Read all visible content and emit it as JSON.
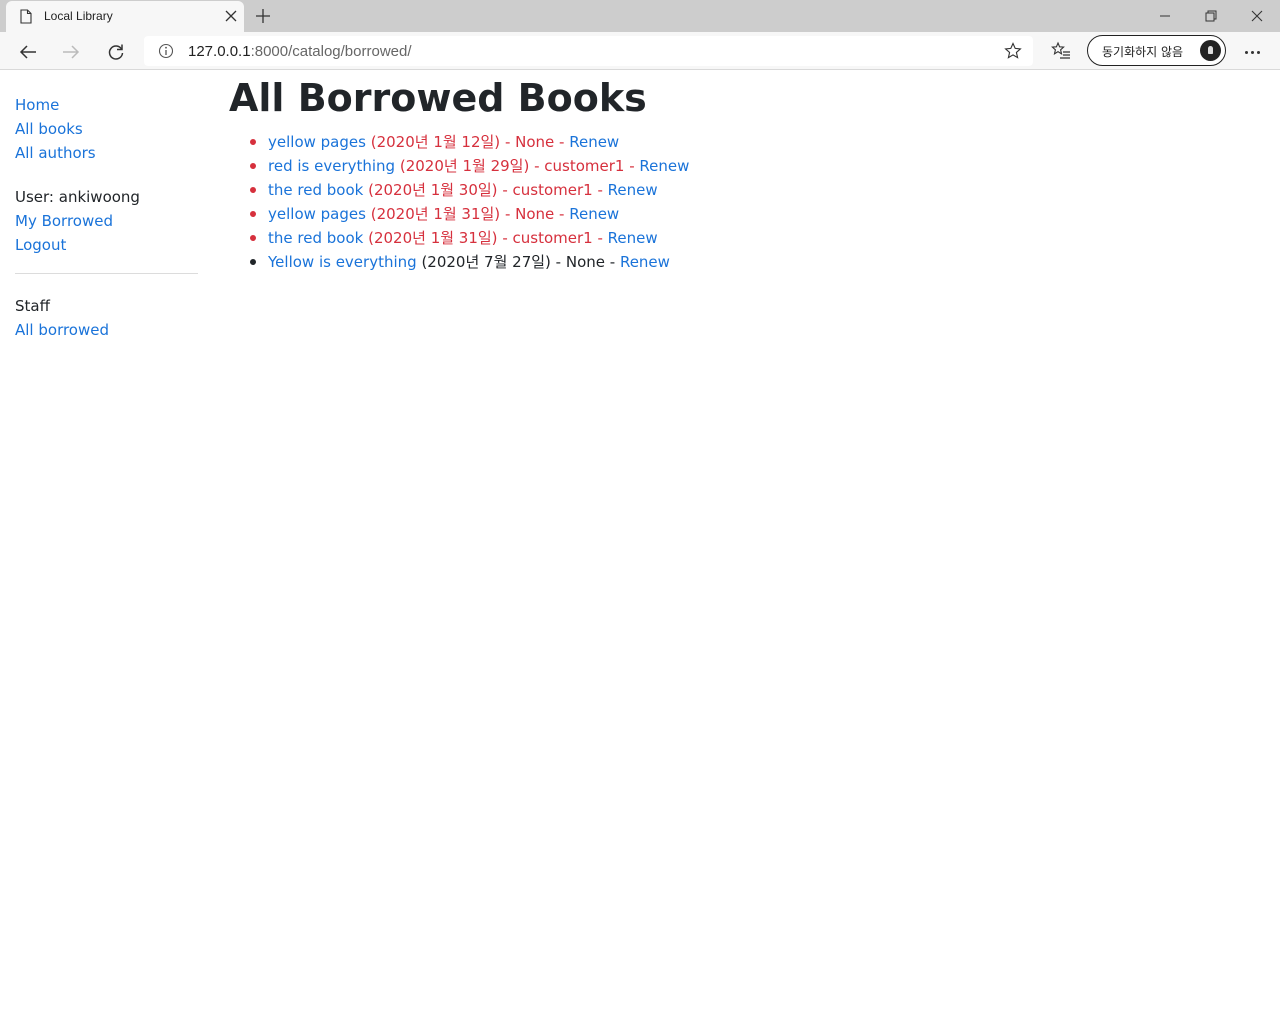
{
  "browser": {
    "tab_title": "Local Library",
    "url_host": "127.0.0.1",
    "url_rest": ":8000/catalog/borrowed/",
    "profile_label": "동기화하지 않음"
  },
  "sidebar": {
    "links": [
      "Home",
      "All books",
      "All authors"
    ],
    "user_label": "User: ankiwoong",
    "user_links": [
      "My Borrowed",
      "Logout"
    ],
    "staff_heading": "Staff",
    "staff_links": [
      "All borrowed"
    ]
  },
  "main": {
    "title": "All Borrowed Books",
    "books": [
      {
        "title": "yellow pages",
        "due": "(2020년 1월 12일)",
        "borrower": "None",
        "action": "Renew",
        "overdue": true
      },
      {
        "title": "red is everything",
        "due": "(2020년 1월 29일)",
        "borrower": "customer1",
        "action": "Renew",
        "overdue": true
      },
      {
        "title": "the red book",
        "due": "(2020년 1월 30일)",
        "borrower": "customer1",
        "action": "Renew",
        "overdue": true
      },
      {
        "title": "yellow pages",
        "due": "(2020년 1월 31일)",
        "borrower": "None",
        "action": "Renew",
        "overdue": true
      },
      {
        "title": "the red book",
        "due": "(2020년 1월 31일)",
        "borrower": "customer1",
        "action": "Renew",
        "overdue": true
      },
      {
        "title": "Yellow is everything",
        "due": "(2020년 7월 27일)",
        "borrower": "None",
        "action": "Renew",
        "overdue": false
      }
    ],
    "separator": " - "
  },
  "colors": {
    "link": "#1a73d9",
    "overdue": "#d6303d",
    "text": "#212529"
  },
  "icons": [
    "page-icon",
    "close-icon",
    "plus-icon",
    "minimize-icon",
    "restore-icon",
    "window-close-icon",
    "back-arrow-icon",
    "forward-arrow-icon",
    "refresh-icon",
    "info-icon",
    "star-icon",
    "favorites-icon",
    "more-icon"
  ]
}
